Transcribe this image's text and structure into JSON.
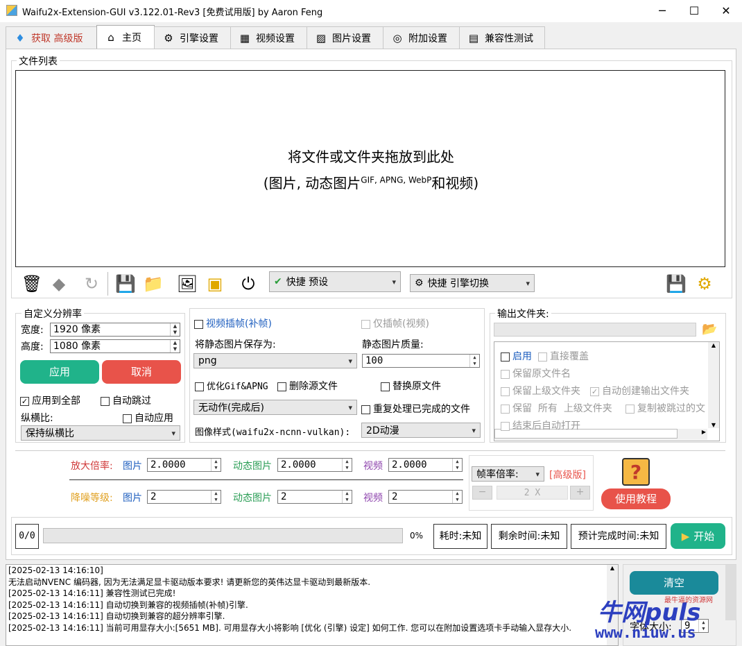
{
  "window": {
    "title": "Waifu2x-Extension-GUI v3.122.01-Rev3 [免费试用版] by Aaron Feng",
    "minimize": "─",
    "maximize": "☐",
    "close": "✕"
  },
  "tabs": [
    {
      "label": "获取 高级版",
      "icon": "diamond-icon"
    },
    {
      "label": "主页",
      "icon": "home-icon"
    },
    {
      "label": "引擎设置",
      "icon": "engine-icon"
    },
    {
      "label": "视频设置",
      "icon": "film-icon"
    },
    {
      "label": "图片设置",
      "icon": "picture-icon"
    },
    {
      "label": "附加设置",
      "icon": "settings-icon"
    },
    {
      "label": "兼容性测试",
      "icon": "test-icon"
    }
  ],
  "file_list": {
    "title": "文件列表",
    "drop_line1": "将文件或文件夹拖放到此处",
    "drop_line2_a": "(图片, 动态图片",
    "drop_line2_sup": "GIF, APNG, WebP",
    "drop_line2_b": "和视频)"
  },
  "toolbar": {
    "preset_label": "快捷 预设",
    "engine_switch_label": "快捷 引擎切换"
  },
  "custom_res": {
    "title": "自定义分辨率",
    "width_label": "宽度:",
    "width_value": "1920 像素",
    "height_label": "高度:",
    "height_value": "1080 像素",
    "apply": "应用",
    "cancel": "取消",
    "apply_all": "应用到全部",
    "auto_skip": "自动跳过",
    "aspect_label": "纵横比:",
    "auto_apply": "自动应用",
    "aspect_value": "保持纵横比"
  },
  "middle": {
    "video_interp": "视频插帧(补帧)",
    "interp_only": "仅插帧(视频)",
    "save_as_label": "将静态图片保存为:",
    "save_as_value": "png",
    "quality_label": "静态图片质量:",
    "quality_value": "100",
    "optimize_gif": "优化Gif&APNG",
    "delete_src": "删除源文件",
    "replace_src": "替换原文件",
    "after_action": "无动作(完成后)",
    "reprocess": "重复处理已完成的文件",
    "style_label": "图像样式(waifu2x-ncnn-vulkan):",
    "style_value": "2D动漫"
  },
  "output": {
    "title": "输出文件夹:",
    "enable": "启用",
    "overwrite": "直接覆盖",
    "keep_name": "保留原文件名",
    "keep_parent": "保留上级文件夹",
    "auto_create": "自动创建输出文件夹",
    "keep": "保留",
    "all": "所有",
    "parent": "上级文件夹",
    "copy_skipped": "复制被跳过的文",
    "open_after": "结束后自动打开"
  },
  "scale": {
    "scale_label": "放大倍率:",
    "denoise_label": "降噪等级:",
    "image": "图片",
    "anim": "动态图片",
    "video": "视频",
    "scale_img": "2.0000",
    "scale_anim": "2.0000",
    "scale_video": "2.0000",
    "dn_img": "2",
    "dn_anim": "2",
    "dn_video": "2",
    "fps_label": "帧率倍率:",
    "premium": "[高级版]",
    "minus": "−",
    "fps_value": "2 X",
    "plus": "+",
    "tutorial": "使用教程"
  },
  "progress": {
    "count": "0/0",
    "percent": "0%",
    "elapsed": "耗时:未知",
    "remaining": "剩余时间:未知",
    "eta": "预计完成时间:未知",
    "start": "开始",
    "fraction": 0
  },
  "log": [
    "[2025-02-13 14:16:10]",
    "无法启动NVENC 编码器, 因为无法满足显卡驱动版本要求! 请更新您的英伟达显卡驱动到最新版本.",
    "[2025-02-13 14:16:11] 兼容性测试已完成!",
    "[2025-02-13 14:16:11] 自动切换到兼容的视频插帧(补帧)引擎.",
    "[2025-02-13 14:16:11] 自动切换到兼容的超分辨率引擎.",
    "[2025-02-13 14:16:11] 当前可用显存大小:[5651 MB]. 可用显存大小将影响 [优化 (引擎) 设定] 如何工作. 您可以在附加设置选项卡手动输入显存大小."
  ],
  "side": {
    "clear": "清空",
    "font_label": "字体大小:",
    "font_value": "9"
  },
  "watermark": {
    "text": "牛网puls",
    "sub": "最牛逼的资源网",
    "url": "www.niuw.us"
  },
  "colors": {
    "green": "#20b38a",
    "red": "#e8534a",
    "accent": "#1f5fbf"
  }
}
